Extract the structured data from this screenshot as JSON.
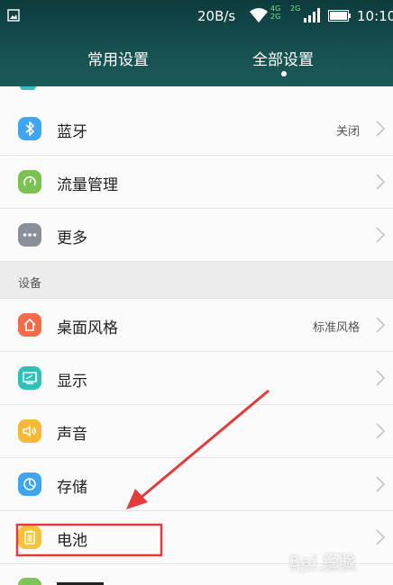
{
  "status_bar": {
    "net_speed": "20B/s",
    "net_label_top": "4G",
    "net_label_bottom": "2G",
    "net_label_2g": "2G",
    "time": "10:10"
  },
  "tabs": [
    {
      "label": "常用设置",
      "selected": false
    },
    {
      "label": "全部设置",
      "selected": true
    }
  ],
  "rows": {
    "bluetooth": {
      "label": "蓝牙",
      "value": "关闭",
      "icon": "bluetooth-icon",
      "color": "#3fa5ee"
    },
    "traffic": {
      "label": "流量管理",
      "icon": "traffic-gauge-icon",
      "color": "#7cc253"
    },
    "more": {
      "label": "更多",
      "icon": "more-dots-icon",
      "color": "#8a8f99"
    },
    "theme": {
      "label": "桌面风格",
      "value": "标准风格",
      "icon": "home-icon",
      "color": "#f26b4b"
    },
    "display": {
      "label": "显示",
      "icon": "display-icon",
      "color": "#2ec2b6"
    },
    "sound": {
      "label": "声音",
      "icon": "speaker-icon",
      "color": "#f5b935"
    },
    "storage": {
      "label": "存储",
      "icon": "storage-pie-icon",
      "color": "#3fa5ee"
    },
    "battery": {
      "label": "电池",
      "icon": "battery-icon",
      "color": "#f5c436"
    }
  },
  "section_device": {
    "title": "设备"
  },
  "annotation": {
    "arrow_color": "#e23b3b",
    "box_color": "#e23b3b"
  },
  "watermark": {
    "text": "Bai 经验",
    "url": "jingyan.baidu.com"
  }
}
